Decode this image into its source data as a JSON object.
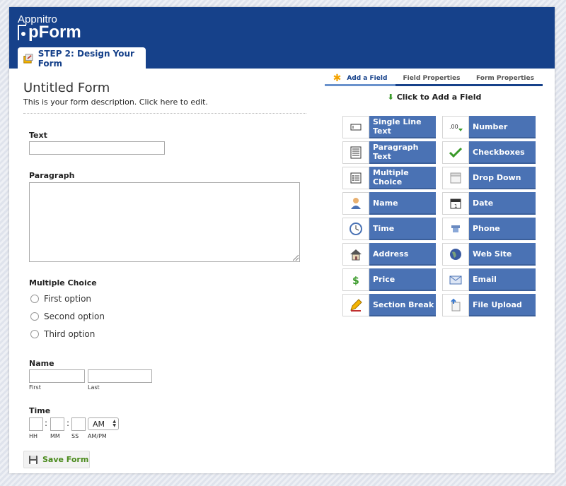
{
  "brand": {
    "top": "Appnitro",
    "main": "pForm"
  },
  "step_tab": "STEP 2: Design Your Form",
  "form": {
    "title": "Untitled Form",
    "description": "This is your form description. Click here to edit.",
    "fields": {
      "text_label": "Text",
      "paragraph_label": "Paragraph",
      "multiple_choice_label": "Multiple Choice",
      "options": [
        "First option",
        "Second option",
        "Third option"
      ],
      "name_label": "Name",
      "name_first": "First",
      "name_last": "Last",
      "time_label": "Time",
      "time_hh": "HH",
      "time_mm": "MM",
      "time_ss": "SS",
      "time_ampm_sub": "AM/PM",
      "time_ampm_value": "AM",
      "colon": ":"
    },
    "save_label": "Save Form"
  },
  "panel": {
    "tabs": [
      "Add a Field",
      "Field Properties",
      "Form Properties"
    ],
    "hint": "Click to Add a Field",
    "buttons": [
      {
        "label": "Single Line Text",
        "icon": "single-line-icon"
      },
      {
        "label": "Number",
        "icon": "number-icon"
      },
      {
        "label": "Paragraph Text",
        "icon": "paragraph-icon"
      },
      {
        "label": "Checkboxes",
        "icon": "checkmark-icon"
      },
      {
        "label": "Multiple Choice",
        "icon": "list-icon"
      },
      {
        "label": "Drop Down",
        "icon": "dropdown-icon"
      },
      {
        "label": "Name",
        "icon": "person-icon"
      },
      {
        "label": "Date",
        "icon": "calendar-icon"
      },
      {
        "label": "Time",
        "icon": "clock-icon"
      },
      {
        "label": "Phone",
        "icon": "phone-icon"
      },
      {
        "label": "Address",
        "icon": "house-icon"
      },
      {
        "label": "Web Site",
        "icon": "globe-icon"
      },
      {
        "label": "Price",
        "icon": "dollar-icon"
      },
      {
        "label": "Email",
        "icon": "envelope-icon"
      },
      {
        "label": "Section Break",
        "icon": "pencil-icon"
      },
      {
        "label": "File Upload",
        "icon": "upload-icon"
      }
    ]
  },
  "colors": {
    "header": "#16418a",
    "button": "#4a72b4",
    "save_text": "#4a8a1c"
  }
}
